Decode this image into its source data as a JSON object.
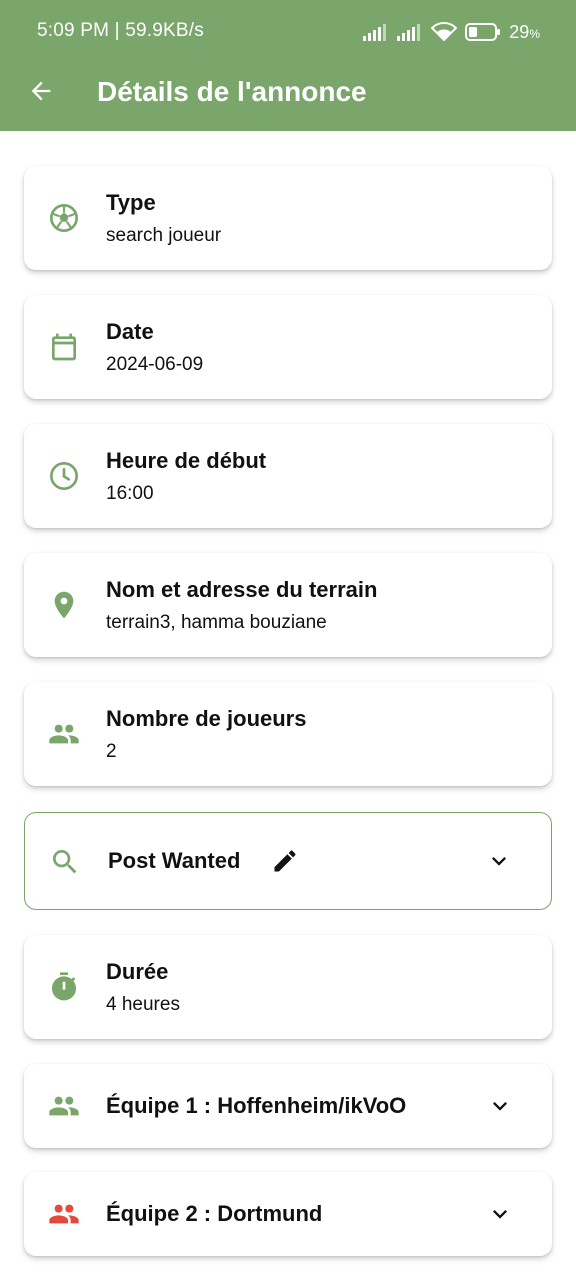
{
  "status_bar": {
    "time_speed": "5:09 PM | 59.9KB/s",
    "battery": "29",
    "battery_unit": "%"
  },
  "header": {
    "title": "Détails de l'annonce",
    "back_icon": "arrow-left-icon"
  },
  "colors": {
    "brand_green": "#7aa56b",
    "team2_red": "#e44a3c"
  },
  "cards": [
    {
      "icon": "soccer-ball-icon",
      "label": "Type",
      "value": "search joueur"
    },
    {
      "icon": "calendar-icon",
      "label": "Date",
      "value": "2024-06-09"
    },
    {
      "icon": "clock-icon",
      "label": "Heure de début",
      "value": "16:00"
    },
    {
      "icon": "location-pin-icon",
      "label": "Nom et adresse du terrain",
      "value": "terrain3, hamma bouziane"
    },
    {
      "icon": "people-icon",
      "label": "Nombre de joueurs",
      "value": "2"
    }
  ],
  "post_wanted": {
    "icon": "search-icon",
    "label": "Post Wanted",
    "edit_icon": "edit-pencil-icon",
    "chevron": "chevron-down-icon"
  },
  "duration": {
    "icon": "stopwatch-icon",
    "label": "Durée",
    "value": "4 heures"
  },
  "teams": [
    {
      "icon": "people-icon",
      "label": "Équipe 1 : Hoffenheim/ikVoO",
      "chevron": "chevron-down-icon"
    },
    {
      "icon": "people-icon",
      "label": "Équipe 2 : Dortmund",
      "chevron": "chevron-down-icon"
    }
  ]
}
